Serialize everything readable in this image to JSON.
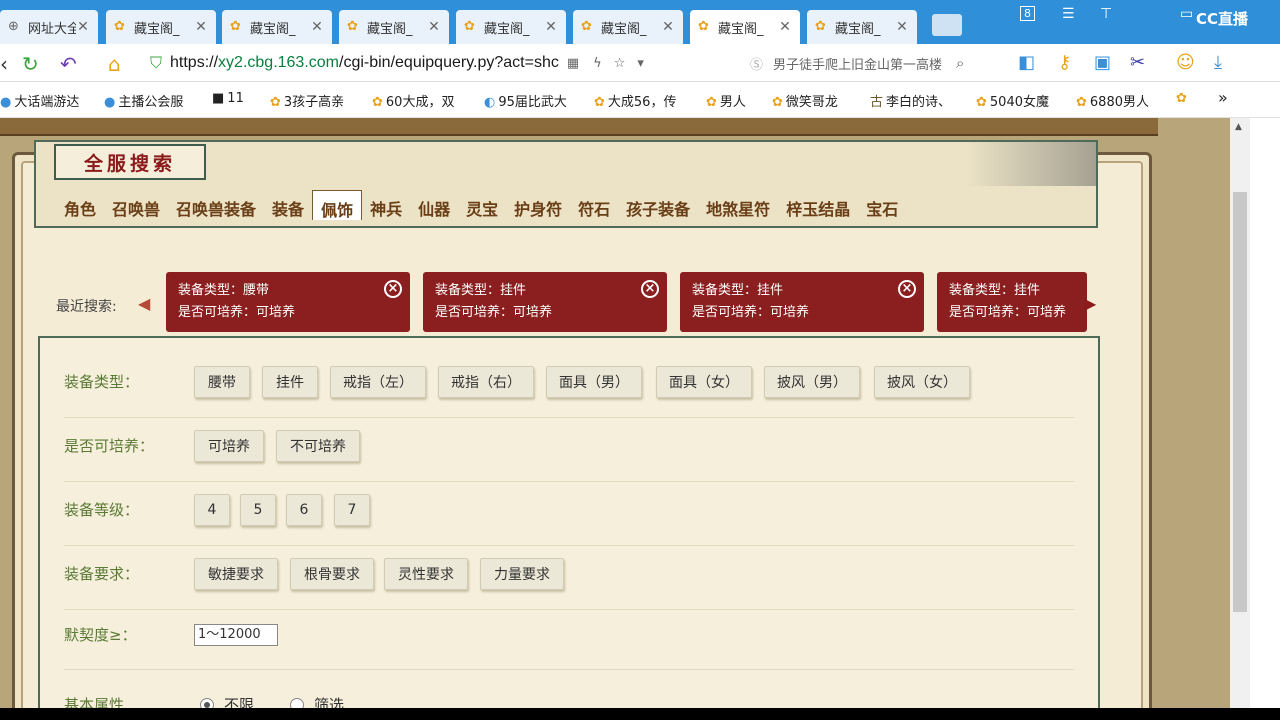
{
  "browser": {
    "tabs": [
      {
        "label": "网址大全"
      },
      {
        "label": "藏宝阁_"
      },
      {
        "label": "藏宝阁_"
      },
      {
        "label": "藏宝阁_"
      },
      {
        "label": "藏宝阁_"
      },
      {
        "label": "藏宝阁_"
      },
      {
        "label": "藏宝阁_"
      },
      {
        "label": "藏宝阁_"
      }
    ],
    "brand": "CC直播",
    "url_scheme": "https://",
    "url_domain": "xy2.cbg.163.com",
    "url_path": "/cgi-bin/equipquery.py?act=shc",
    "search_text": "男子徒手爬上旧金山第一高楼",
    "bookmarks": [
      "大话端游达",
      "主播公会服",
      "11",
      "3孩子高亲",
      "60大成，双",
      "95届比武大",
      "大成56，传",
      "男人",
      "微笑哥龙",
      "李白的诗、",
      "5040女魔",
      "6880男人"
    ],
    "tab_count_badge": "8"
  },
  "page": {
    "title": "全服搜索",
    "categories": [
      "角色",
      "召唤兽",
      "召唤兽装备",
      "装备",
      "佩饰",
      "神兵",
      "仙器",
      "灵宝",
      "护身符",
      "符石",
      "孩子装备",
      "地煞星符",
      "梓玉结晶",
      "宝石"
    ],
    "active_category": "佩饰",
    "recent_label": "最近搜索:",
    "recent": [
      {
        "line1": "装备类型：腰带",
        "line2": "是否可培养：可培养"
      },
      {
        "line1": "装备类型：挂件",
        "line2": "是否可培养：可培养"
      },
      {
        "line1": "装备类型：挂件",
        "line2": "是否可培养：可培养"
      },
      {
        "line1": "装备类型：挂件",
        "line2": "是否可培养：可培养"
      }
    ],
    "filters": {
      "type_label": "装备类型：",
      "type_options": [
        "腰带",
        "挂件",
        "戒指（左）",
        "戒指（右）",
        "面具（男）",
        "面具（女）",
        "披风（男）",
        "披风（女）"
      ],
      "cultivate_label": "是否可培养：",
      "cultivate_options": [
        "可培养",
        "不可培养"
      ],
      "level_label": "装备等级：",
      "level_options": [
        "4",
        "5",
        "6",
        "7"
      ],
      "req_label": "装备要求：",
      "req_options": [
        "敏捷要求",
        "根骨要求",
        "灵性要求",
        "力量要求"
      ],
      "tacit_label": "默契度≥：",
      "tacit_placeholder": "1～12000",
      "base_label": "基本属性",
      "base_options": [
        "不限",
        "筛选"
      ]
    }
  }
}
